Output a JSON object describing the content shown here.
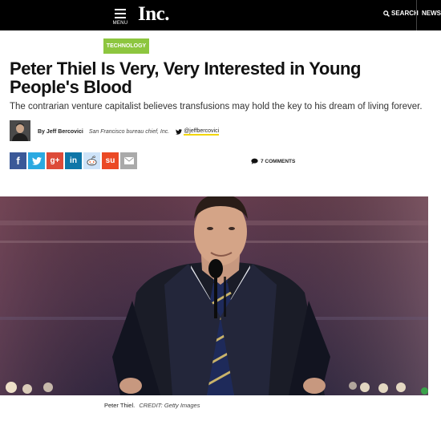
{
  "header": {
    "menu_label": "MENU",
    "logo_text": "Inc.",
    "search_label": "SEARCH",
    "newsletter_label": "NEWSL"
  },
  "article": {
    "category": "TECHNOLOGY",
    "headline": "Peter Thiel Is Very, Very Interested in Young People's Blood",
    "dek": "The contrarian venture capitalist believes transfusions may hold the key to his dream of living forever.",
    "author": "By Jeff Bercovici",
    "author_role": "San Francisco bureau chief, Inc.",
    "twitter_handle": "@jeffbercovici",
    "comments_label": "7 COMMENTS"
  },
  "share_buttons": [
    {
      "name": "facebook",
      "glyph": "f",
      "color": "#3b5998"
    },
    {
      "name": "twitter",
      "glyph": "t",
      "color": "#2ba9e1"
    },
    {
      "name": "google-plus",
      "glyph": "g+",
      "color": "#dd4b39"
    },
    {
      "name": "linkedin",
      "glyph": "in",
      "color": "#0e76a8"
    },
    {
      "name": "reddit",
      "glyph": "r",
      "color": "#cee3f8"
    },
    {
      "name": "stumbleupon",
      "glyph": "su",
      "color": "#eb4924"
    },
    {
      "name": "email",
      "glyph": "✉",
      "color": "#aaaaaa"
    }
  ],
  "photo": {
    "caption": "Peter Thiel.",
    "credit": "CREDIT: Getty Images"
  },
  "colors": {
    "topbar": "#000000",
    "tag_green": "#8dc63f",
    "handle_underline": "#f2d600"
  }
}
